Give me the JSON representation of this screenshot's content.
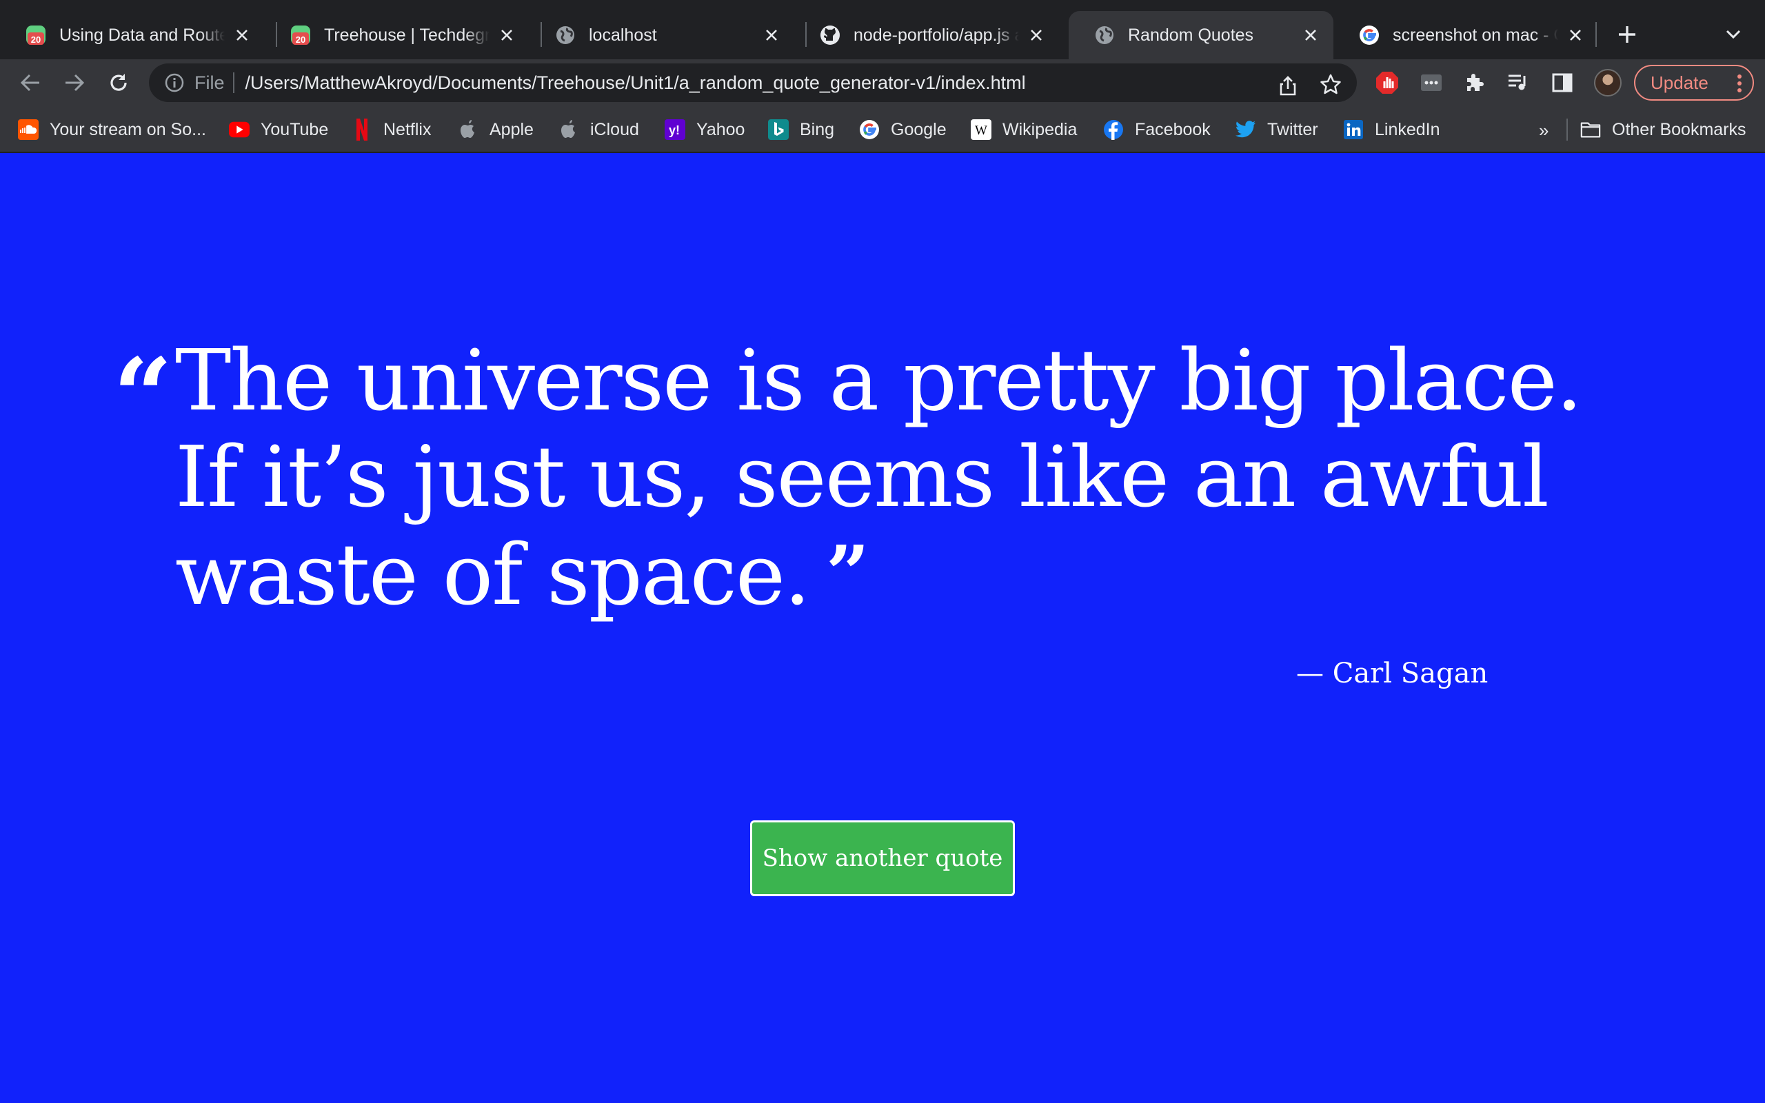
{
  "tabs": [
    {
      "title": "Using Data and Route",
      "icon": "treehouse-icon"
    },
    {
      "title": "Treehouse | Techdegree",
      "icon": "treehouse-icon"
    },
    {
      "title": "localhost",
      "icon": "globe-icon"
    },
    {
      "title": "node-portfolio/app.js at",
      "icon": "github-icon"
    },
    {
      "title": "Random Quotes",
      "icon": "globe-icon",
      "active": true
    },
    {
      "title": "screenshot on mac - G",
      "icon": "google-icon"
    }
  ],
  "toolbar": {
    "scheme": "File",
    "url": "/Users/MatthewAkroyd/Documents/Treehouse/Unit1/a_random_quote_generator-v1/index.html",
    "update_label": "Update"
  },
  "bookmarks": [
    {
      "label": "Your stream on So...",
      "icon": "soundcloud-icon"
    },
    {
      "label": "YouTube",
      "icon": "youtube-icon"
    },
    {
      "label": "Netflix",
      "icon": "netflix-icon"
    },
    {
      "label": "Apple",
      "icon": "apple-icon"
    },
    {
      "label": "iCloud",
      "icon": "apple-icon"
    },
    {
      "label": "Yahoo",
      "icon": "yahoo-icon"
    },
    {
      "label": "Bing",
      "icon": "bing-icon"
    },
    {
      "label": "Google",
      "icon": "google-icon"
    },
    {
      "label": "Wikipedia",
      "icon": "wikipedia-icon"
    },
    {
      "label": "Facebook",
      "icon": "facebook-icon"
    },
    {
      "label": "Twitter",
      "icon": "twitter-icon"
    },
    {
      "label": "LinkedIn",
      "icon": "linkedin-icon"
    }
  ],
  "bookmarks_overflow": "»",
  "other_bookmarks": "Other Bookmarks",
  "page": {
    "open_mark": "“",
    "quote": "The universe is a pretty big place. If it’s just us, seems like an awful waste of space.",
    "close_mark": "”",
    "author": "— Carl Sagan",
    "button_label": "Show another quote",
    "background_color": "#1122fb",
    "button_color": "#3bb44f"
  }
}
